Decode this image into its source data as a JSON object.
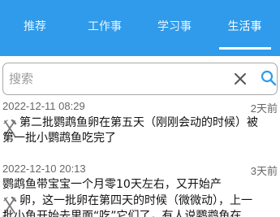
{
  "tabs": [
    {
      "label": "推荐",
      "active": false
    },
    {
      "label": "工作事",
      "active": false
    },
    {
      "label": "学习事",
      "active": false
    },
    {
      "label": "生活事",
      "active": true
    }
  ],
  "search": {
    "placeholder": "搜索",
    "value": ""
  },
  "icons": {
    "clear": "close-icon",
    "search": "search-icon",
    "item": "fork-knife-icon"
  },
  "colors": {
    "accent": "#2f9bea",
    "text": "#111111",
    "muted": "#666666"
  },
  "feed": [
    {
      "date": "2022-12-11 08:29",
      "ago": "2天前",
      "lines": [
        "第二批鹦鹉鱼卵在第五天（刚刚会动的时候）被",
        "第一批小鹦鹉鱼吃完了"
      ]
    },
    {
      "date": "2022-12-10 20:13",
      "ago": "3天前",
      "lines": [
        "鹦鹉鱼带宝宝一个月零10天左右，又开始产",
        "卵，这一批卵在第四天的时候（微微动），上一",
        "批小鱼开始去里面“吃”它们了，有人说鹦鹉鱼在"
      ]
    }
  ]
}
